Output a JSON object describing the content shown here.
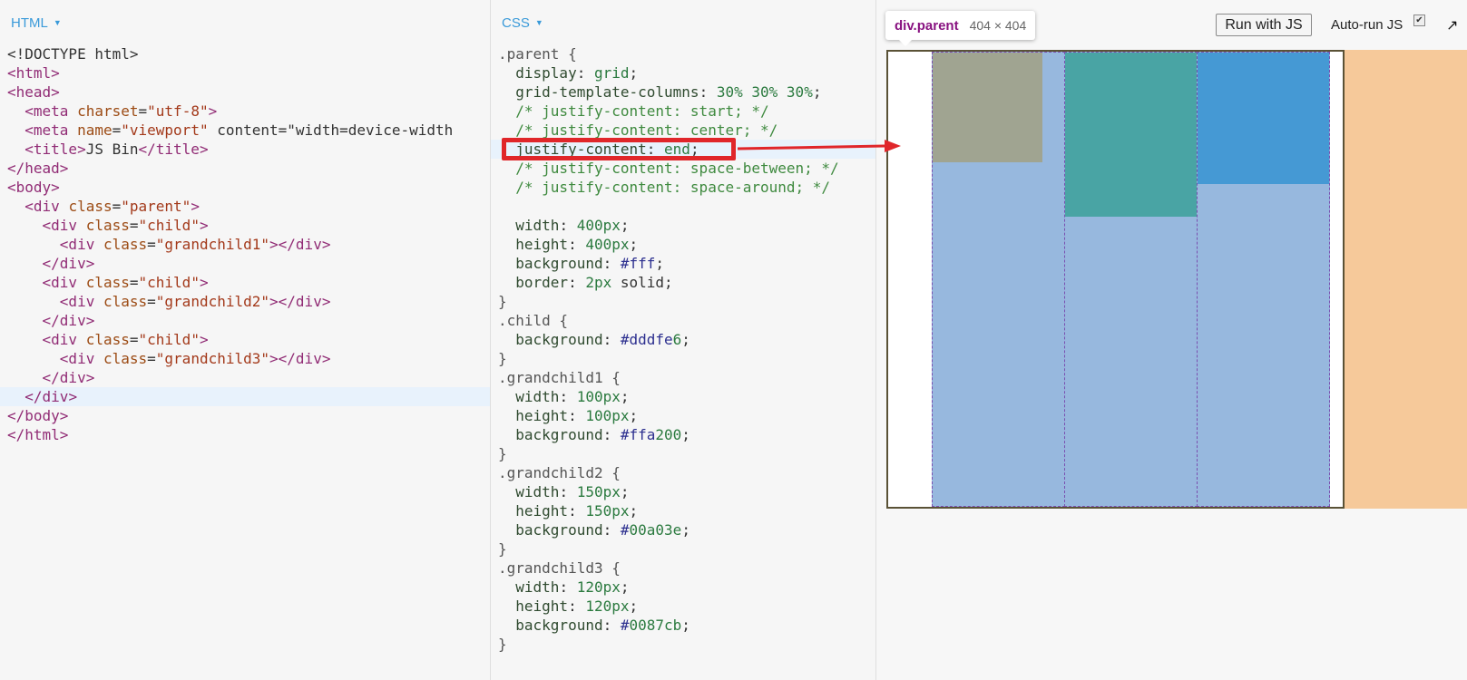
{
  "html_panel": {
    "label": "HTML",
    "lines": [
      "<!DOCTYPE html>",
      "<html>",
      "<head>",
      "  <meta charset=\"utf-8\">",
      "  <meta name=\"viewport\" content=\"width=device-width",
      "  <title>JS Bin</title>",
      "</head>",
      "<body>",
      "  <div class=\"parent\">",
      "    <div class=\"child\">",
      "      <div class=\"grandchild1\"></div>",
      "    </div>",
      "    <div class=\"child\">",
      "      <div class=\"grandchild2\"></div>",
      "    </div>",
      "    <div class=\"child\">",
      "      <div class=\"grandchild3\"></div>",
      "    </div>",
      "  </div>",
      "</body>",
      "</html>"
    ]
  },
  "css_panel": {
    "label": "CSS",
    "lines": [
      ".parent {",
      "  display: grid;",
      "  grid-template-columns: 30% 30% 30%;",
      "  /* justify-content: start; */",
      "  /* justify-content: center; */",
      "  justify-content: end;",
      "  /* justify-content: space-between; */",
      "  /* justify-content: space-around; */",
      "",
      "  width: 400px;",
      "  height: 400px;",
      "  background: #fff;",
      "  border: 2px solid;",
      "}",
      ".child {",
      "  background: #dddfe6;",
      "}",
      ".grandchild1 {",
      "  width: 100px;",
      "  height: 100px;",
      "  background: #ffa200;",
      "}",
      ".grandchild2 {",
      "  width: 150px;",
      "  height: 150px;",
      "  background: #00a03e;",
      "}",
      ".grandchild3 {",
      "  width: 120px;",
      "  height: 120px;",
      "  background: #0087cb;",
      "}"
    ]
  },
  "output": {
    "tooltip_element": "div.parent",
    "tooltip_size": "404 × 404",
    "run_button": "Run with JS",
    "autorun_label": "Auto-run JS",
    "autorun_checked": "✔",
    "expand_glyph": "↗"
  },
  "colors": {
    "grandchild1_overlay": "#a0a491",
    "grandchild2_overlay": "#49a4a4",
    "grandchild3_overlay": "#4599d4",
    "child_overlay": "#97b8de",
    "margin_overlay": "#f6c99a",
    "highlight_red": "#e0262a"
  }
}
